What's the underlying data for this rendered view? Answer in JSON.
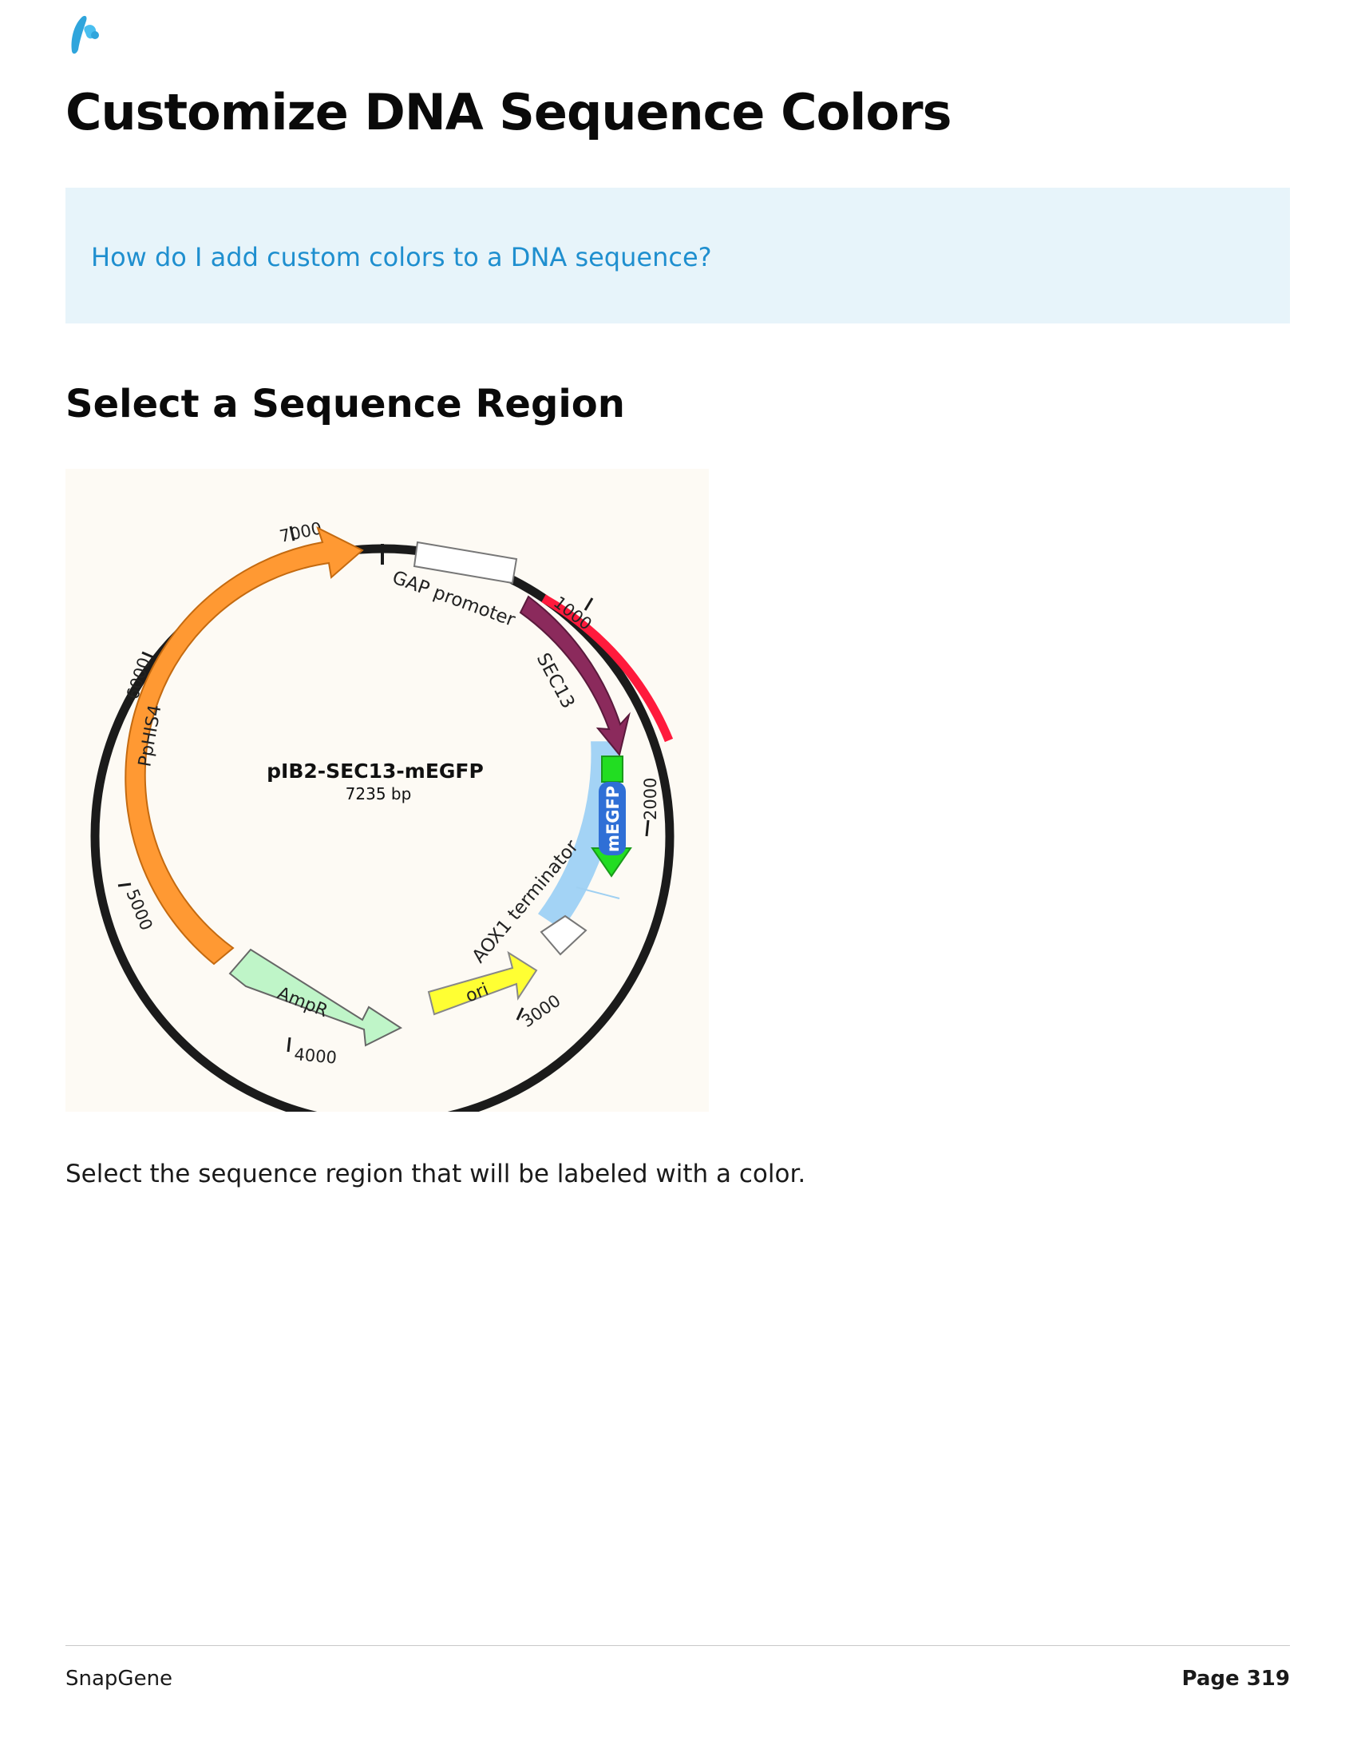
{
  "logo": {
    "icon": "snapgene-logo-icon",
    "color": "#2fa5dc"
  },
  "page_title": "Customize DNA Sequence Colors",
  "callout": {
    "link_text": "How do I add custom colors to a DNA sequence?"
  },
  "section_title": "Select a Sequence Region",
  "plasmid_map": {
    "name": "pIB2-SEC13-mEGFP",
    "length_label": "7235 bp",
    "total_bp": 7235,
    "ticks": [
      {
        "label": "1000",
        "bp": 1000
      },
      {
        "label": "2000",
        "bp": 2000
      },
      {
        "label": "3000",
        "bp": 3000
      },
      {
        "label": "4000",
        "bp": 4000
      },
      {
        "label": "5000",
        "bp": 5000
      },
      {
        "label": "6000",
        "bp": 6000
      },
      {
        "label": "7000",
        "bp": 7000
      }
    ],
    "features": [
      {
        "label": "GAP promoter",
        "color": "#ffffff",
        "shape": "box"
      },
      {
        "label": "SEC13",
        "color": "#8b2a5c",
        "shape": "arrow"
      },
      {
        "label": "mEGFP",
        "color": "#22dd22",
        "label_badge_color": "#2f6fd6",
        "shape": "arrow"
      },
      {
        "label": "AOX1 terminator",
        "color": "#ffffff",
        "shape": "box"
      },
      {
        "label": "ori",
        "color": "#ffff33",
        "shape": "arrow"
      },
      {
        "label": "AmpR",
        "color": "#bff5c8",
        "shape": "arrow"
      },
      {
        "label": "PpHIS4",
        "color": "#ff9933",
        "shape": "arrow"
      }
    ],
    "colored_region_color": "#ff1a3c",
    "selection_color": "#9fd0f2"
  },
  "body_text": "Select the sequence region that will be labeled with a color.",
  "footer": {
    "brand": "SnapGene",
    "page_label": "Page 319"
  }
}
